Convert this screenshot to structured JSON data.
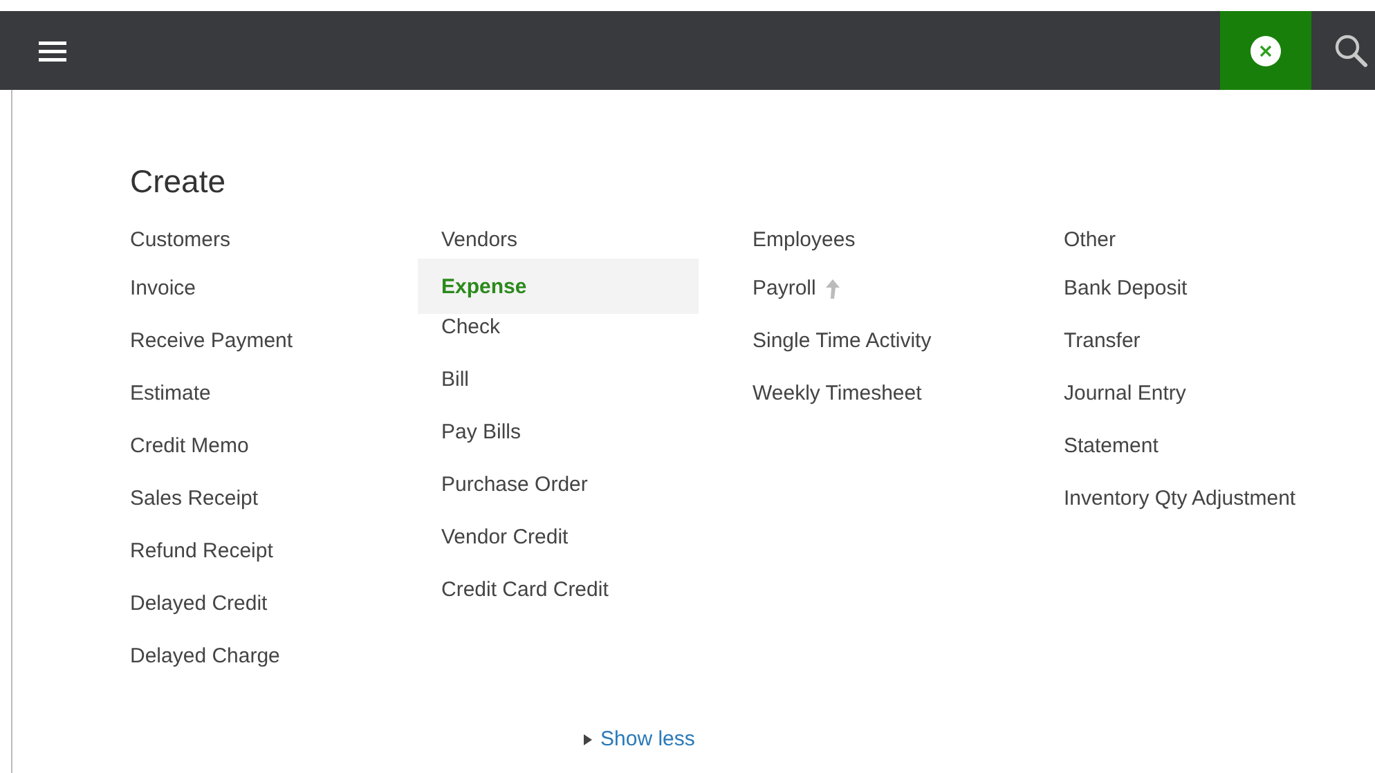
{
  "title": "Create",
  "columns": [
    {
      "heading": "Customers",
      "items": [
        {
          "label": "Invoice",
          "selected": false,
          "upgrade": false
        },
        {
          "label": "Receive Payment",
          "selected": false,
          "upgrade": false
        },
        {
          "label": "Estimate",
          "selected": false,
          "upgrade": false
        },
        {
          "label": "Credit Memo",
          "selected": false,
          "upgrade": false
        },
        {
          "label": "Sales Receipt",
          "selected": false,
          "upgrade": false
        },
        {
          "label": "Refund Receipt",
          "selected": false,
          "upgrade": false
        },
        {
          "label": "Delayed Credit",
          "selected": false,
          "upgrade": false
        },
        {
          "label": "Delayed Charge",
          "selected": false,
          "upgrade": false
        }
      ]
    },
    {
      "heading": "Vendors",
      "items": [
        {
          "label": "Expense",
          "selected": true,
          "upgrade": false
        },
        {
          "label": "Check",
          "selected": false,
          "upgrade": false
        },
        {
          "label": "Bill",
          "selected": false,
          "upgrade": false
        },
        {
          "label": "Pay Bills",
          "selected": false,
          "upgrade": false
        },
        {
          "label": "Purchase Order",
          "selected": false,
          "upgrade": false
        },
        {
          "label": "Vendor Credit",
          "selected": false,
          "upgrade": false
        },
        {
          "label": "Credit Card Credit",
          "selected": false,
          "upgrade": false
        }
      ]
    },
    {
      "heading": "Employees",
      "items": [
        {
          "label": "Payroll",
          "selected": false,
          "upgrade": true
        },
        {
          "label": "Single Time Activity",
          "selected": false,
          "upgrade": false
        },
        {
          "label": "Weekly Timesheet",
          "selected": false,
          "upgrade": false
        }
      ]
    },
    {
      "heading": "Other",
      "items": [
        {
          "label": "Bank Deposit",
          "selected": false,
          "upgrade": false
        },
        {
          "label": "Transfer",
          "selected": false,
          "upgrade": false
        },
        {
          "label": "Journal Entry",
          "selected": false,
          "upgrade": false
        },
        {
          "label": "Statement",
          "selected": false,
          "upgrade": false
        },
        {
          "label": "Inventory Qty Adjustment",
          "selected": false,
          "upgrade": false
        }
      ]
    }
  ],
  "show_less": "Show less"
}
